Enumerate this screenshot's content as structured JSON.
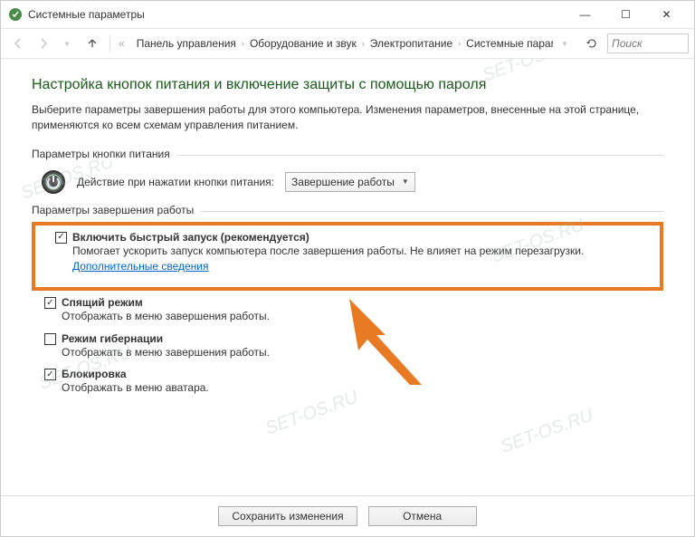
{
  "window": {
    "title": "Системные параметры"
  },
  "window_controls": {
    "min": "—",
    "max": "☐",
    "close": "✕"
  },
  "breadcrumb": {
    "items": [
      "Панель управления",
      "Оборудование и звук",
      "Электропитание",
      "Системные параметры"
    ]
  },
  "search": {
    "placeholder": "Поиск"
  },
  "heading": "Настройка кнопок питания и включение защиты с помощью пароля",
  "lead": "Выберите параметры завершения работы для этого компьютера. Изменения параметров, внесенные на этой странице, применяются ко всем схемам управления питанием.",
  "section_power_btn": {
    "legend": "Параметры кнопки питания"
  },
  "power_action": {
    "label": "Действие при нажатии кнопки питания:",
    "value": "Завершение работы"
  },
  "section_shutdown": {
    "legend": "Параметры завершения работы"
  },
  "fast_startup": {
    "title": "Включить быстрый запуск (рекомендуется)",
    "desc": "Помогает ускорить запуск компьютера после завершения работы. Не влияет на режим перезагрузки.",
    "link": "Дополнительные сведения",
    "checked": true
  },
  "sleep": {
    "title": "Спящий режим",
    "desc": "Отображать в меню завершения работы.",
    "checked": true
  },
  "hibernate": {
    "title": "Режим гибернации",
    "desc": "Отображать в меню завершения работы.",
    "checked": false
  },
  "lock": {
    "title": "Блокировка",
    "desc": "Отображать в меню аватара.",
    "checked": true
  },
  "buttons": {
    "save": "Сохранить изменения",
    "cancel": "Отмена"
  },
  "watermark": "SET-OS.RU"
}
